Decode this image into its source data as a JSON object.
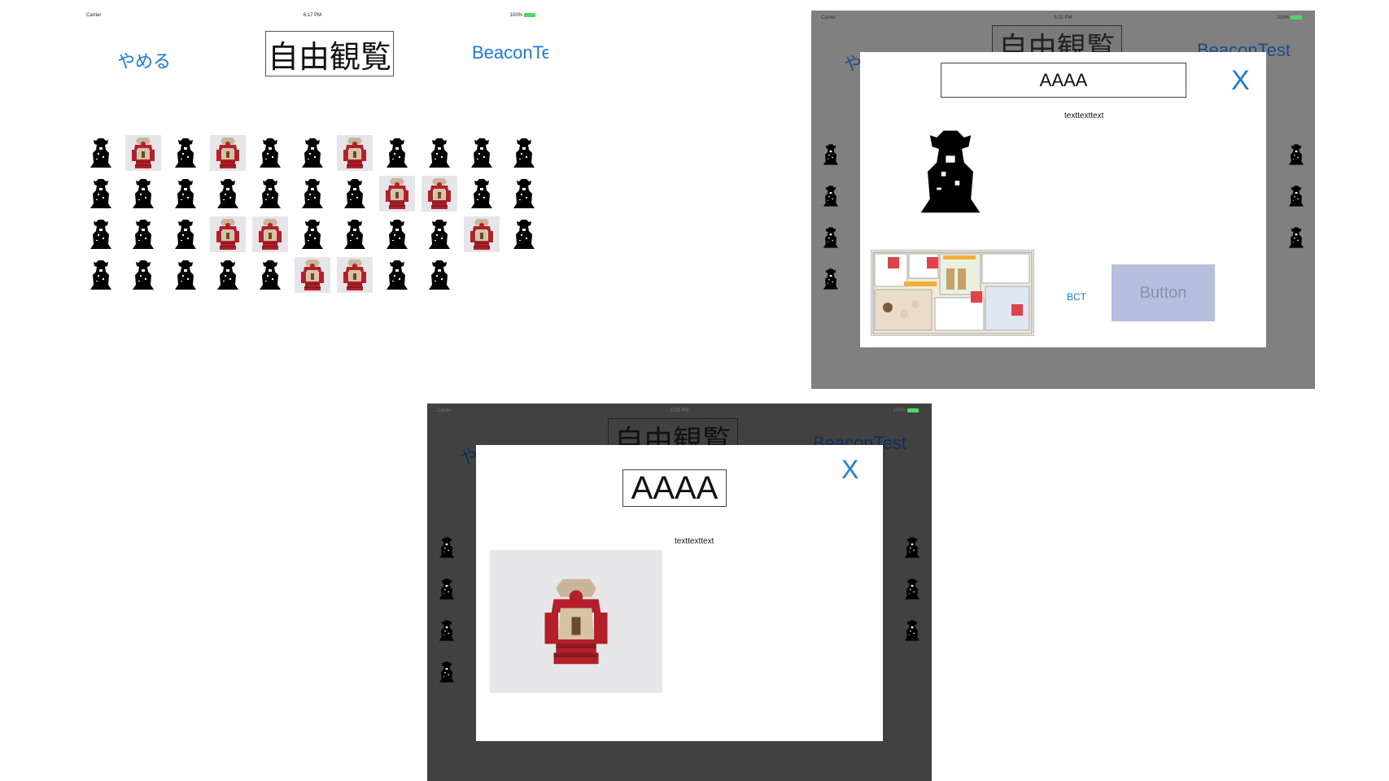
{
  "screen_list": {
    "status": {
      "carrier": "Carrier",
      "time": "6:17 PM",
      "battery": "100%"
    },
    "cancel_label": "やめる",
    "title": "自由観覧",
    "beacon_label": "BeaconTest",
    "grid_pattern": [
      0,
      1,
      0,
      1,
      0,
      0,
      1,
      0,
      0,
      0,
      0,
      0,
      0,
      0,
      0,
      0,
      0,
      0,
      0,
      1,
      1,
      0,
      0,
      0,
      0,
      0,
      0,
      1,
      1,
      0,
      0,
      0,
      0,
      1,
      0,
      0,
      0,
      0,
      0,
      0,
      0,
      1,
      1,
      0,
      0
    ]
  },
  "screen_dialog_map": {
    "status": {
      "carrier": "Carrier",
      "time": "6:02 PM",
      "battery": "100%"
    },
    "background_title": "自由観覧",
    "background_beacon_label": "BeaconTest",
    "background_cancel_partial": "や",
    "modal": {
      "title": "AAAA",
      "close_label": "X",
      "description": "texttexttext",
      "bct_label": "BCT",
      "button_label": "Button"
    }
  },
  "screen_dialog_photo": {
    "status": {
      "carrier": "Carrier",
      "time": "6:03 PM",
      "battery": "100%"
    },
    "background_title": "自由観覧",
    "background_beacon_label": "BeaconTest",
    "background_cancel_partial": "や",
    "modal": {
      "title": "AAAA",
      "close_label": "X",
      "description": "texttexttext"
    }
  },
  "colors": {
    "accent": "#1a7ae6",
    "dim_light": "#808080",
    "dim_dark": "#414141",
    "armor_red": "#b3202a",
    "disabled_button_bg": "#b6bfdd"
  }
}
